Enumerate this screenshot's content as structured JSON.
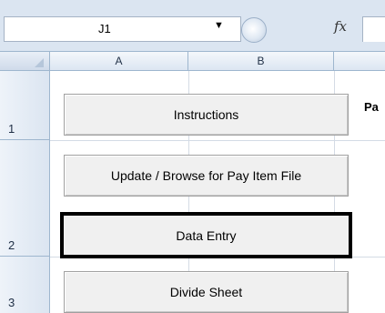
{
  "formula_bar": {
    "name_box": "J1",
    "fx_label": "fx"
  },
  "columns": [
    "A",
    "B",
    ""
  ],
  "rows": [
    "1",
    "2",
    "3"
  ],
  "buttons": {
    "instructions": "Instructions",
    "update_browse": "Update / Browse for Pay Item File",
    "data_entry": "Data Entry",
    "divide_sheet": "Divide Sheet"
  },
  "cells": {
    "c1_partial": "Pa"
  }
}
